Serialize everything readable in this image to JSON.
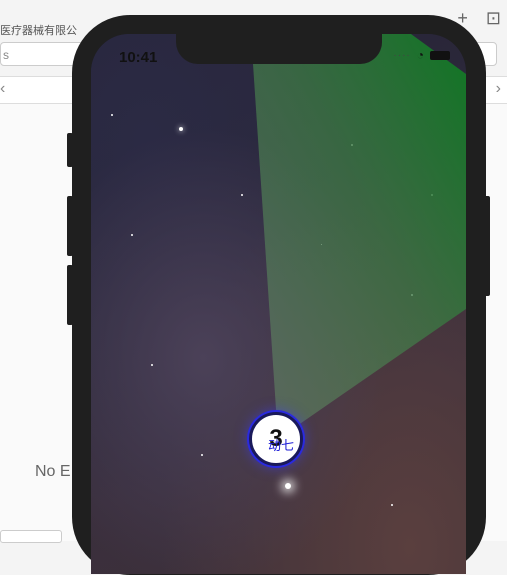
{
  "background_app": {
    "title": "医疗器械有限公",
    "input_text": "s",
    "empty_state": "No E",
    "toolbar_icons": [
      "plus-icon",
      "inspector-icon"
    ]
  },
  "phone": {
    "status_time": "10:41",
    "status_icons": [
      "cellular-dots-icon",
      "wifi-icon",
      "battery-icon"
    ],
    "beam_color": "#0e7a22",
    "badge": {
      "number": "3",
      "label": "动七",
      "ring_color": "#2a2adf"
    }
  }
}
